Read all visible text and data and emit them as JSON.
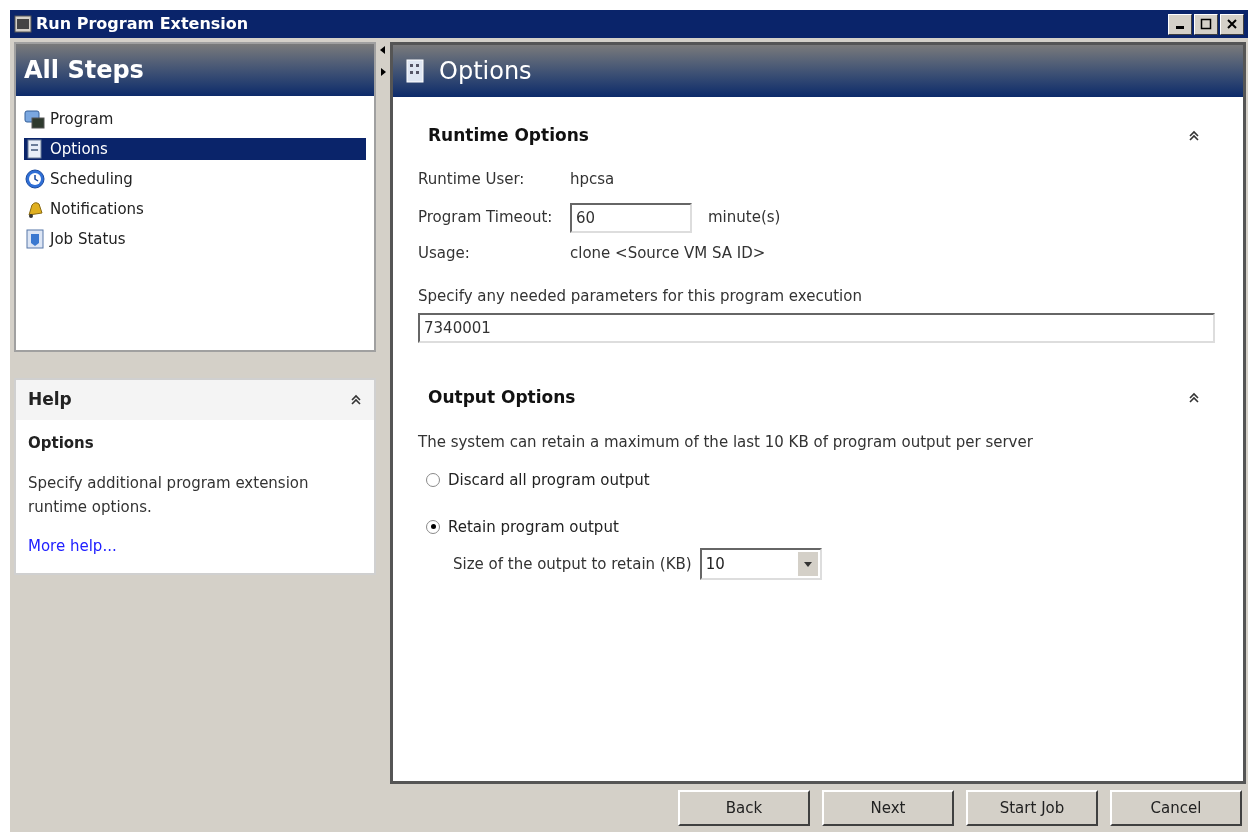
{
  "window": {
    "title": "Run Program Extension"
  },
  "steps_panel": {
    "title": "All Steps"
  },
  "steps": [
    {
      "label": "Program",
      "selected": false
    },
    {
      "label": "Options",
      "selected": true
    },
    {
      "label": "Scheduling",
      "selected": false
    },
    {
      "label": "Notifications",
      "selected": false
    },
    {
      "label": "Job Status",
      "selected": false
    }
  ],
  "help": {
    "title": "Help",
    "expanded": true,
    "heading": "Options",
    "text": "Specify additional program extension runtime options.",
    "link": "More help..."
  },
  "main": {
    "title": "Options"
  },
  "runtime_options": {
    "title": "Runtime Options",
    "expanded": true,
    "user_label": "Runtime User:",
    "user_value": "hpcsa",
    "timeout_label": "Program Timeout:",
    "timeout_value": "60",
    "timeout_unit": "minute(s)",
    "usage_label": "Usage:",
    "usage_value": "clone <Source VM SA ID>",
    "params_label": "Specify any needed parameters for this program execution",
    "params_value": "7340001"
  },
  "output_options": {
    "title": "Output Options",
    "expanded": true,
    "description": "The system can retain a maximum of the last 10 KB of program output per server",
    "choices": [
      {
        "label": "Discard all program output",
        "selected": false
      },
      {
        "label": "Retain program output",
        "selected": true
      }
    ],
    "size_label": "Size of the output to retain (KB)",
    "size_value": "10"
  },
  "buttons": [
    "Back",
    "Next",
    "Start Job",
    "Cancel"
  ]
}
